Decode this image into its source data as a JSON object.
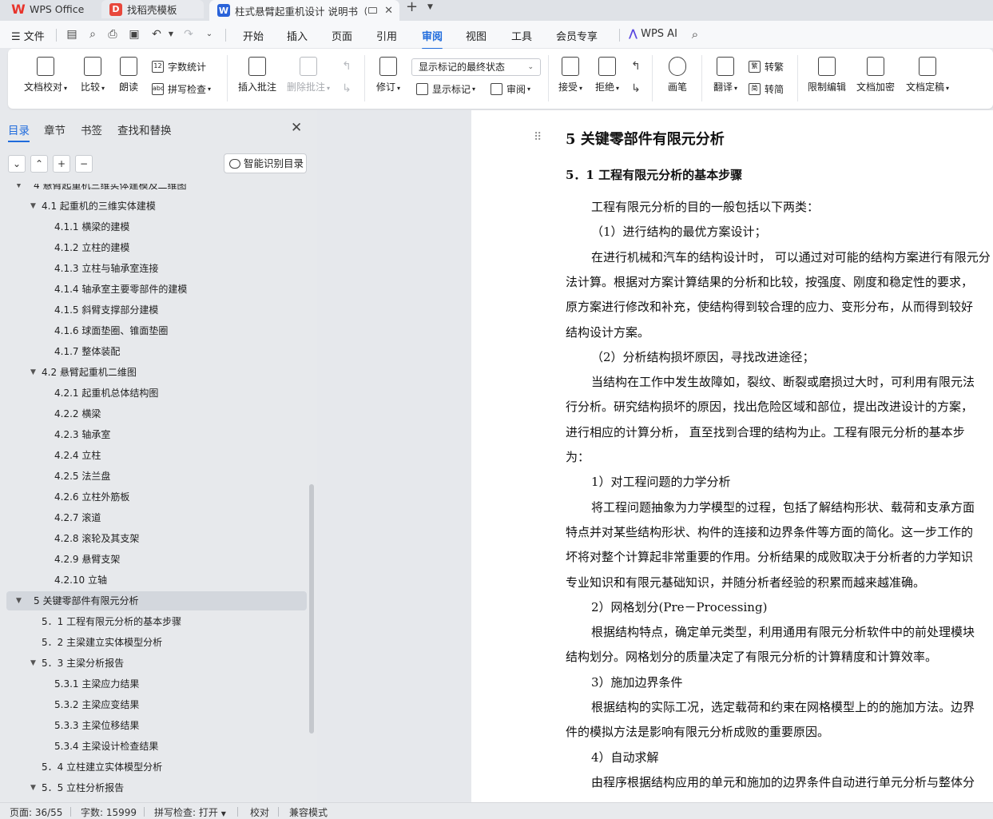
{
  "tabs": [
    {
      "label": "WPS Office",
      "icon": "wps-logo-icon"
    },
    {
      "label": "找稻壳模板",
      "icon": "daoke-logo-icon"
    },
    {
      "label": "柱式悬臂起重机设计 说明书（",
      "icon": "word-doc-icon"
    }
  ],
  "menu": {
    "file": "文件",
    "items": [
      "开始",
      "插入",
      "页面",
      "引用",
      "审阅",
      "视图",
      "工具",
      "会员专享"
    ],
    "active": "审阅",
    "wps_ai": "WPS AI"
  },
  "ribbon": {
    "doc_proofread": "文档校对",
    "compare": "比较",
    "read_aloud": "朗读",
    "word_count": "字数统计",
    "spell_check": "拼写检查",
    "insert_comment": "插入批注",
    "delete_comment": "删除批注",
    "track_changes": "修订",
    "markup_state": "显示标记的最终状态",
    "show_markup": "显示标记",
    "review": "审阅",
    "accept": "接受",
    "reject": "拒绝",
    "pen": "画笔",
    "translate": "翻译",
    "to_traditional": "转繁",
    "to_simplified": "转简",
    "restrict_edit": "限制编辑",
    "encrypt": "文档加密",
    "finalize": "文档定稿"
  },
  "nav": {
    "tabs": [
      "目录",
      "章节",
      "书签",
      "查找和替换"
    ],
    "active_tab": "目录",
    "smart_toc": "智能识别目录",
    "toc": [
      {
        "text": "4   悬臂起重机三维实体建模及二维图",
        "level": 1,
        "twisty": "▼"
      },
      {
        "text": "4.1    起重机的三维实体建模",
        "level": 2,
        "twisty": "▼"
      },
      {
        "text": "4.1.1  横梁的建模",
        "level": 3
      },
      {
        "text": "4.1.2  立柱的建模",
        "level": 3
      },
      {
        "text": "4.1.3 立柱与轴承室连接",
        "level": 3
      },
      {
        "text": "4.1.4 轴承室主要零部件的建模",
        "level": 3
      },
      {
        "text": "4.1.5  斜臂支撑部分建模",
        "level": 3
      },
      {
        "text": "4.1.6  球面垫圈、锥面垫圈",
        "level": 3
      },
      {
        "text": "4.1.7   整体装配",
        "level": 3
      },
      {
        "text": "4.2    悬臂起重机二维图",
        "level": 2,
        "twisty": "▼"
      },
      {
        "text": "4.2.1 起重机总体结构图",
        "level": 3
      },
      {
        "text": "4.2.2 横梁",
        "level": 3
      },
      {
        "text": "4.2.3 轴承室",
        "level": 3
      },
      {
        "text": "4.2.4 立柱",
        "level": 3
      },
      {
        "text": "4.2.5 法兰盘",
        "level": 3
      },
      {
        "text": "4.2.6 立柱外筋板",
        "level": 3
      },
      {
        "text": "4.2.7 滚道",
        "level": 3
      },
      {
        "text": "4.2.8 滚轮及其支架",
        "level": 3
      },
      {
        "text": "4.2.9 悬臂支架",
        "level": 3
      },
      {
        "text": "4.2.10 立轴",
        "level": 3
      },
      {
        "text": "5   关键零部件有限元分析",
        "level": 1,
        "twisty": "▼",
        "selected": true
      },
      {
        "text": "5．1    工程有限元分析的基本步骤",
        "level": 2
      },
      {
        "text": "5．2    主梁建立实体模型分析",
        "level": 2
      },
      {
        "text": "5．3    主梁分析报告",
        "level": 2,
        "twisty": "▼"
      },
      {
        "text": "5.3.1    主梁应力结果",
        "level": 3
      },
      {
        "text": "5.3.2    主梁应变结果",
        "level": 3
      },
      {
        "text": "5.3.3    主梁位移结果",
        "level": 3
      },
      {
        "text": "5.3.4    主梁设计检查结果",
        "level": 3
      },
      {
        "text": "5．4    立柱建立实体模型分析",
        "level": 2
      },
      {
        "text": "5．5    立柱分析报告",
        "level": 2,
        "twisty": "▼"
      }
    ]
  },
  "document": {
    "heading1": "5    关键零部件有限元分析",
    "heading2": "5．1    工程有限元分析的基本步骤",
    "lines": [
      {
        "text": "工程有限元分析的目的一般包括以下两类：",
        "indent": true
      },
      {
        "text": "（1）进行结构的最优方案设计；",
        "indent": true
      },
      {
        "text": "在进行机械和汽车的结构设计时，  可以通过对可能的结构方案进行有限元分",
        "indent": true
      },
      {
        "text": "法计算。根据对方案计算结果的分析和比较，按强度、刚度和稳定性的要求，",
        "indent": false
      },
      {
        "text": "原方案进行修改和补充，使结构得到较合理的应力、变形分布，从而得到较好",
        "indent": false
      },
      {
        "text": "结构设计方案。",
        "indent": false
      },
      {
        "text": "（2）分析结构损坏原因，寻找改进途径；",
        "indent": true
      },
      {
        "text": "当结构在工作中发生故障如，裂纹、断裂或磨损过大时，可利用有限元法",
        "indent": true
      },
      {
        "text": "行分析。研究结构损坏的原因，找出危险区域和部位，提出改进设计的方案，",
        "indent": false
      },
      {
        "text": "进行相应的计算分析，  直至找到合理的结构为止。工程有限元分析的基本步",
        "indent": false
      },
      {
        "text": "为：",
        "indent": false
      },
      {
        "text": "1）对工程问题的力学分析",
        "indent": true
      },
      {
        "text": "将工程问题抽象为力学模型的过程，包括了解结构形状、载荷和支承方面",
        "indent": true
      },
      {
        "text": "特点并对某些结构形状、构件的连接和边界条件等方面的简化。这一步工作的",
        "indent": false
      },
      {
        "text": "坏将对整个计算起非常重要的作用。分析结果的成败取决于分析者的力学知识",
        "indent": false
      },
      {
        "text": "专业知识和有限元基础知识，并随分析者经验的积累而越来越准确。",
        "indent": false
      },
      {
        "text": "2）网格划分(Pre－Processing)",
        "indent": true
      },
      {
        "text": "根据结构特点，确定单元类型，利用通用有限元分析软件中的前处理模块",
        "indent": true
      },
      {
        "text": "结构划分。网格划分的质量决定了有限元分析的计算精度和计算效率。",
        "indent": false
      },
      {
        "text": "3）施加边界条件",
        "indent": true
      },
      {
        "text": "根据结构的实际工况，选定载荷和约束在网格模型上的的施加方法。边界",
        "indent": true
      },
      {
        "text": "件的模拟方法是影响有限元分析成败的重要原因。",
        "indent": false
      },
      {
        "text": "4）自动求解",
        "indent": true
      },
      {
        "text": "由程序根据结构应用的单元和施加的边界条件自动进行单元分析与整体分",
        "indent": true
      }
    ]
  },
  "status": {
    "page": "页面: 36/55",
    "words": "字数: 15999",
    "spell": "拼写检查: 打开",
    "proof": "校对",
    "compat": "兼容模式"
  }
}
